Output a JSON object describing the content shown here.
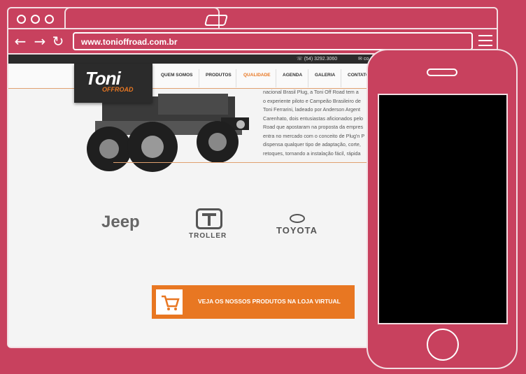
{
  "browser": {
    "url": "www.tonioffroad.com.br",
    "back_icon": "arrow-left-icon",
    "forward_icon": "arrow-right-icon",
    "reload_icon": "reload-icon",
    "menu_icon": "hamburger-menu-icon"
  },
  "site": {
    "contact": {
      "phone": "(54) 3292.3060",
      "email": "co"
    },
    "logo": {
      "line1": "Toni",
      "line2": "OFFROAD"
    },
    "nav": [
      "QUEM SOMOS",
      "PRODUTOS",
      "QUALIDADE",
      "AGENDA",
      "GALERIA",
      "CONTATO"
    ],
    "active_nav": "QUALIDADE",
    "about_lines": [
      "nacional Brasil Plug, a Toni Off Road tem a",
      "o experiente piloto e Campeão Brasileiro de",
      "Toni Ferrarini, ladeado por Anderson Argent",
      "Carenhato, dois entusiastas aficionados pelo",
      "Road que apostaram na proposta da empres",
      "entra no mercado com o conceito de Plug'n P",
      "dispensa qualquer tipo de adaptação, corte,",
      "retoques, tornando a instalação fácil, rápida"
    ],
    "brands": [
      "Jeep",
      "TROLLER",
      "TOYOTA"
    ],
    "cta_label": "VEJA OS NOSSOS PRODUTOS NA LOJA VIRTUAL",
    "accent_color": "#e87722"
  },
  "colors": {
    "background": "#c8415e",
    "frame": "#f3dde2",
    "accent": "#e87722"
  }
}
